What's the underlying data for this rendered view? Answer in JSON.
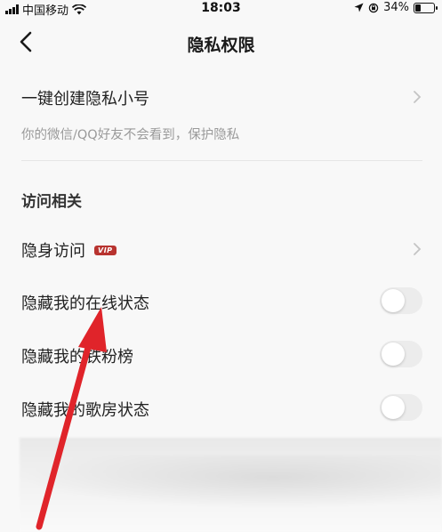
{
  "status_bar": {
    "carrier": "中国移动",
    "time": "18:03",
    "battery": "34%",
    "battery_level": 0.34
  },
  "nav": {
    "title": "隐私权限",
    "back_icon": "chevron-left-icon"
  },
  "private_account": {
    "label": "一键创建隐私小号",
    "description": "你的微信/QQ好友不会看到，保护隐私"
  },
  "visit_section": {
    "title": "访问相关",
    "items": [
      {
        "label": "隐身访问",
        "badge": "VIP",
        "control": "chevron"
      },
      {
        "label": "隐藏我的在线状态",
        "control": "toggle",
        "on": false
      },
      {
        "label": "隐藏我的铁粉榜",
        "control": "toggle",
        "on": false
      },
      {
        "label": "隐藏我的歌房状态",
        "control": "toggle",
        "on": false
      }
    ]
  },
  "colors": {
    "badge": "#b8332f",
    "annotation_arrow": "#e0242a",
    "toggle_off": "#ececec"
  }
}
